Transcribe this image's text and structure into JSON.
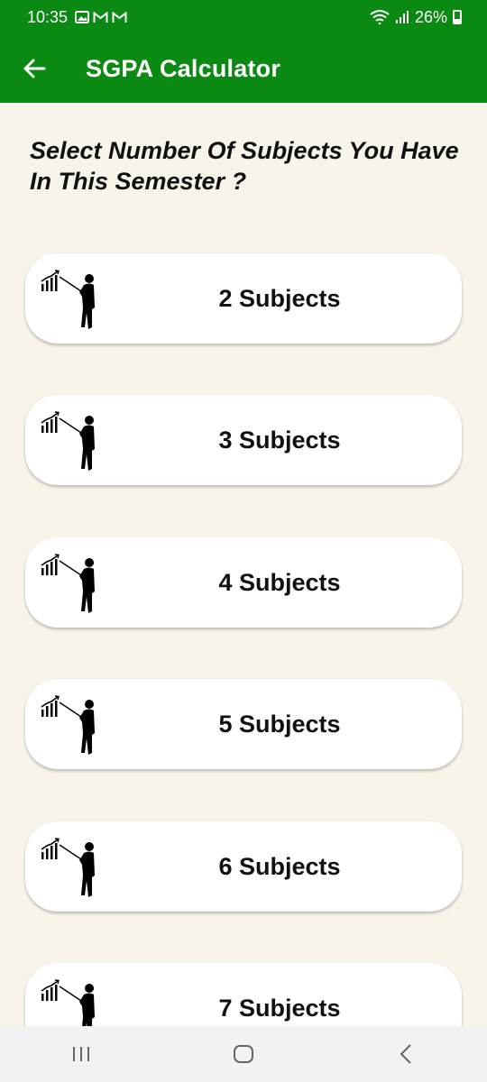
{
  "status_bar": {
    "time": "10:35",
    "notification_icons": [
      "image-icon",
      "gmail-icon",
      "gmail-icon"
    ],
    "battery": "26%"
  },
  "app_bar": {
    "title": "SGPA Calculator",
    "background": "#0a8a12"
  },
  "question": "Select Number Of Subjects You Have In This Semester ?",
  "options": [
    {
      "label": "2 Subjects",
      "icon": "presenter-chart-icon"
    },
    {
      "label": "3 Subjects",
      "icon": "presenter-chart-icon"
    },
    {
      "label": "4 Subjects",
      "icon": "presenter-chart-icon"
    },
    {
      "label": "5 Subjects",
      "icon": "presenter-chart-icon"
    },
    {
      "label": "6 Subjects",
      "icon": "presenter-chart-icon"
    },
    {
      "label": "7 Subjects",
      "icon": "presenter-chart-icon"
    }
  ],
  "nav_bar": [
    "recents-button",
    "home-button",
    "back-button"
  ]
}
